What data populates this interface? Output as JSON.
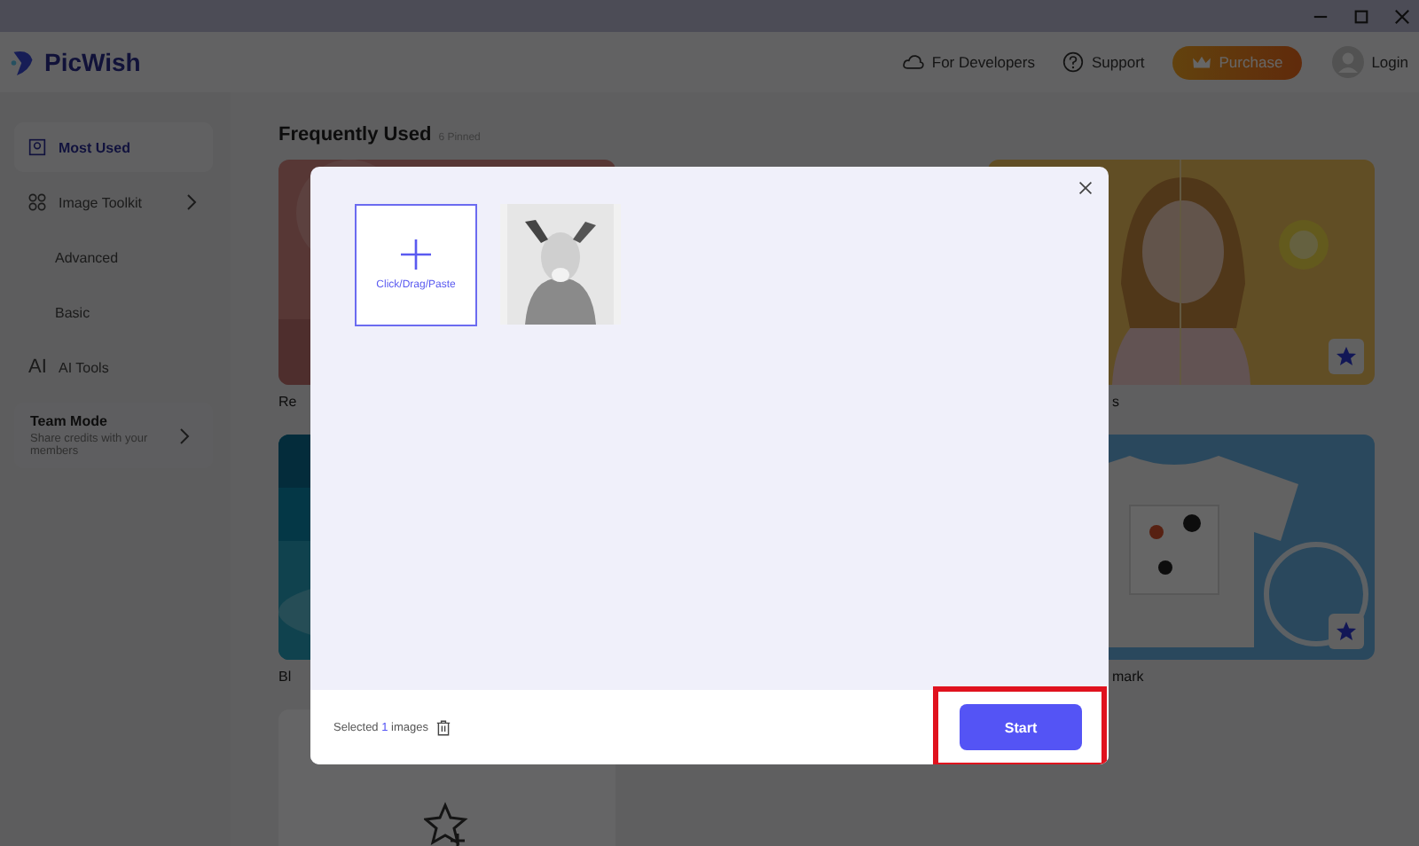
{
  "app": {
    "name": "PicWish"
  },
  "header": {
    "links": [
      {
        "kind": "api",
        "label": "For Developers"
      },
      {
        "kind": "help",
        "label": "Support"
      }
    ],
    "purchase": "Purchase",
    "login": "Login"
  },
  "sidebar": {
    "items": [
      {
        "kind": "most",
        "label": "Most Used",
        "selected": true
      },
      {
        "kind": "grid",
        "label": "Image Toolkit",
        "selected": false,
        "children": [
          {
            "label": "Advanced",
            "selected": false
          },
          {
            "label": "Basic",
            "selected": false
          }
        ]
      },
      {
        "kind": "ai",
        "badge": "AI",
        "label": "AI Tools",
        "selected": false
      }
    ],
    "team": {
      "title": "Team Mode",
      "subtitle": "Share credits with your members"
    }
  },
  "content": {
    "title": "Frequently Used",
    "count": "6 Pinned",
    "rows": [
      {
        "left": {
          "kind": "rose",
          "label": "Re"
        },
        "right": {
          "kind": "portrait",
          "label": "s",
          "pinned": true
        }
      },
      {
        "left": {
          "kind": "ocean",
          "label": "Bl"
        },
        "right": {
          "kind": "tshirt",
          "label": "mark",
          "pinned": true
        }
      },
      {
        "left": {
          "kind": "add"
        }
      }
    ]
  },
  "modal": {
    "upload": {
      "label": "Click/Drag/Paste"
    },
    "footer": {
      "prefix": "Selected",
      "count": "1",
      "suffix": "images"
    },
    "start": "Start",
    "highlighted": true
  }
}
